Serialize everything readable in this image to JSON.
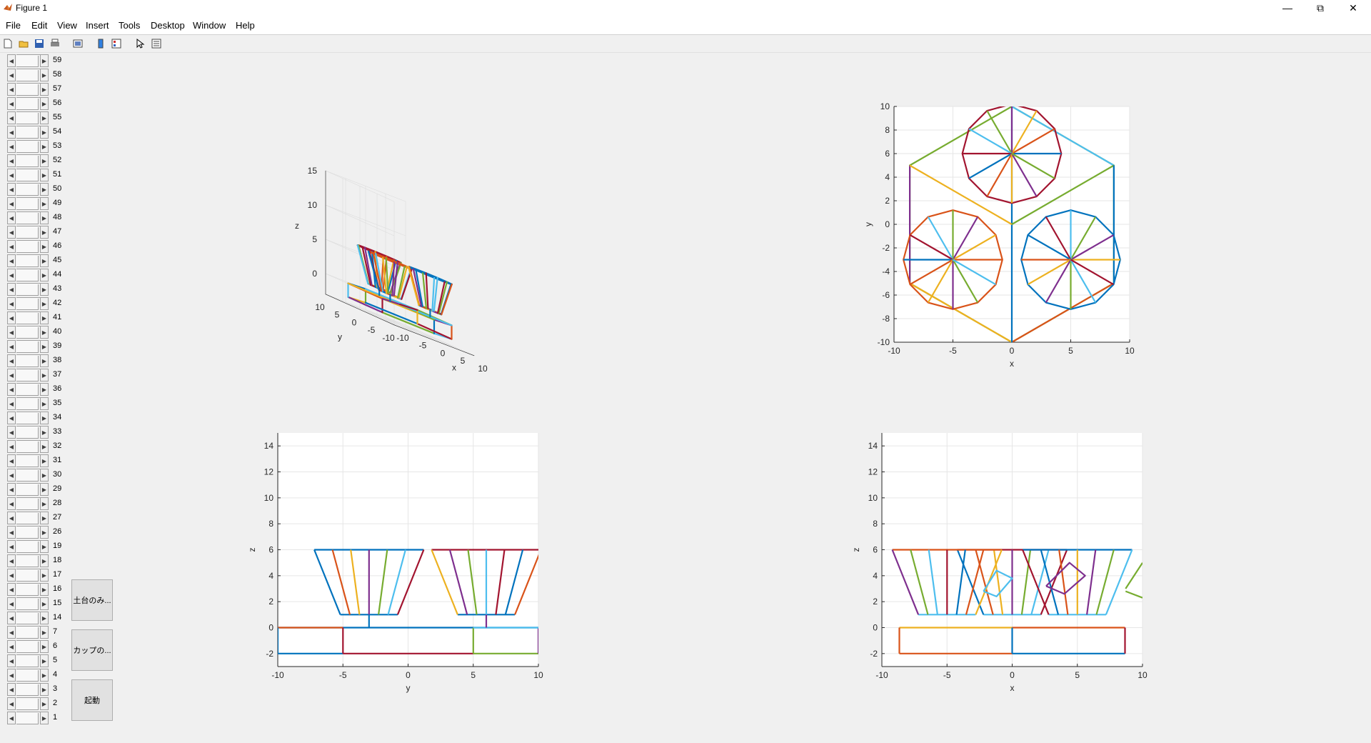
{
  "window": {
    "title": "Figure 1"
  },
  "menu": [
    "File",
    "Edit",
    "View",
    "Insert",
    "Tools",
    "Desktop",
    "Window",
    "Help"
  ],
  "toolbar_icons": [
    "new-figure-icon",
    "open-icon",
    "save-icon",
    "print-icon",
    "link-icon",
    "colorbar-icon",
    "legend-icon",
    "pointer-icon",
    "property-editor-icon"
  ],
  "sliders": {
    "labels": [
      "59",
      "58",
      "57",
      "56",
      "55",
      "54",
      "53",
      "52",
      "51",
      "50",
      "49",
      "48",
      "47",
      "46",
      "45",
      "44",
      "43",
      "42",
      "41",
      "40",
      "39",
      "38",
      "37",
      "36",
      "35",
      "34",
      "33",
      "32",
      "31",
      "30",
      "29",
      "28",
      "27",
      "26",
      "19",
      "18",
      "17",
      "16",
      "15",
      "14",
      "7",
      "6",
      "5",
      "4",
      "3",
      "2",
      "1"
    ]
  },
  "buttons": {
    "base_only": "土台のみ...",
    "cup": "カップの...",
    "start": "起動"
  },
  "colors": {
    "blue": "#0072BD",
    "orange": "#D95319",
    "yellow": "#EDB120",
    "purple": "#7E2F8E",
    "green": "#77AC30",
    "cyan": "#4DBEEE",
    "red": "#A2142F"
  },
  "plot3d": {
    "xlabel": "x",
    "ylabel": "y",
    "zlabel": "z",
    "xticks": [
      "-10",
      "-5",
      "0",
      "5",
      "10"
    ],
    "yticks": [
      "-10",
      "-5",
      "0",
      "5",
      "10"
    ],
    "zticks": [
      "0",
      "5",
      "10",
      "15"
    ]
  },
  "chart_data": [
    {
      "type": "line",
      "xlabel": "x",
      "ylabel": "y",
      "xlim": [
        -10,
        10
      ],
      "ylim": [
        -10,
        10
      ],
      "xticks": [
        "-10",
        "-5",
        "0",
        "5",
        "10"
      ],
      "yticks": [
        "-10",
        "-8",
        "-6",
        "-4",
        "-2",
        "0",
        "2",
        "4",
        "6",
        "8",
        "10"
      ],
      "grid": true
    },
    {
      "type": "line",
      "xlabel": "y",
      "ylabel": "z",
      "xlim": [
        -10,
        10
      ],
      "ylim": [
        -3,
        15
      ],
      "xticks": [
        "-10",
        "-5",
        "0",
        "5",
        "10"
      ],
      "yticks": [
        "-2",
        "0",
        "2",
        "4",
        "6",
        "8",
        "10",
        "12",
        "14"
      ],
      "grid": true
    },
    {
      "type": "line",
      "xlabel": "x",
      "ylabel": "z",
      "xlim": [
        -10,
        10
      ],
      "ylim": [
        -3,
        15
      ],
      "xticks": [
        "-10",
        "-5",
        "0",
        "5",
        "10"
      ],
      "yticks": [
        "-2",
        "0",
        "2",
        "4",
        "6",
        "8",
        "10",
        "12",
        "14"
      ],
      "grid": true
    }
  ]
}
